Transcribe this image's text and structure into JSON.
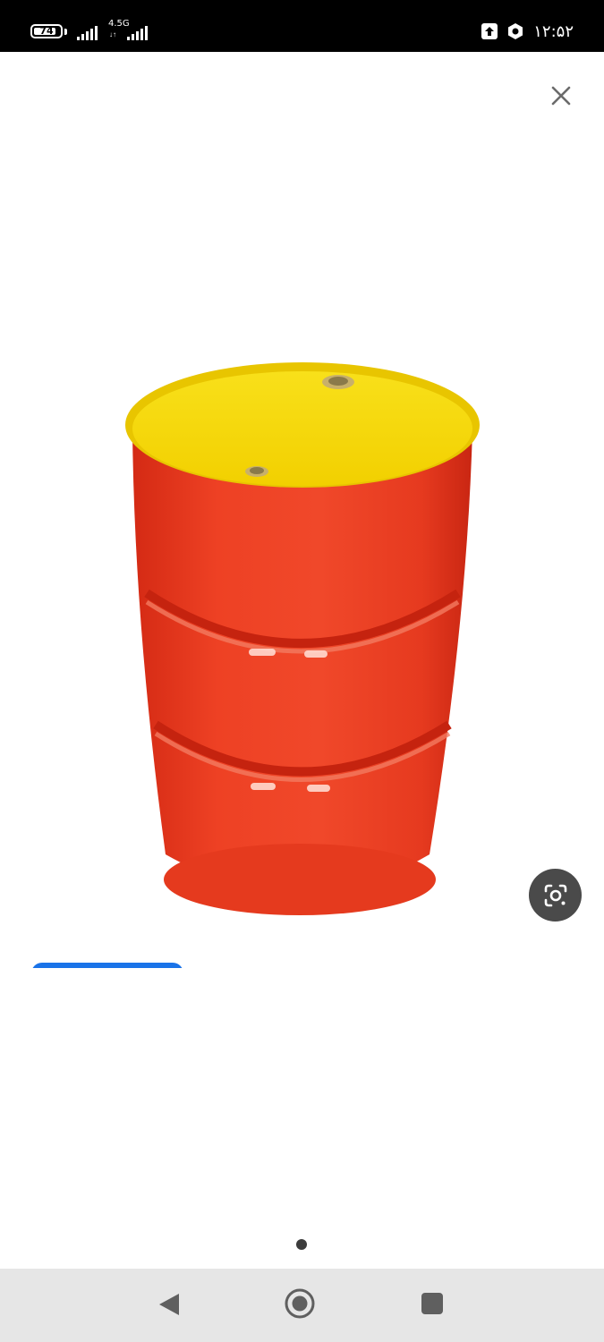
{
  "status_bar": {
    "battery_level": "74",
    "network_type": "4.5G",
    "network_arrows": "↓↑",
    "time": "۱۲:۵۲",
    "icons": [
      "battery-icon",
      "signal-icon",
      "upload-icon",
      "hexagon-icon"
    ]
  },
  "viewer": {
    "close_icon": "close-icon",
    "image_subject": "red-yellow-steel-drum",
    "lens_icon": "google-lens-icon",
    "page_indicator": {
      "current": 1,
      "total": 1
    }
  },
  "nav_bar": {
    "icons": [
      "back-icon",
      "home-icon",
      "recents-icon"
    ]
  },
  "colors": {
    "status_bar": "#000000",
    "background": "#ffffff",
    "drum_body": "#e8371e",
    "drum_lid": "#f5d90a",
    "lens_button": "#4a4a4a",
    "accent_blue": "#1a73e8",
    "nav_bar": "#e6e6e6"
  }
}
